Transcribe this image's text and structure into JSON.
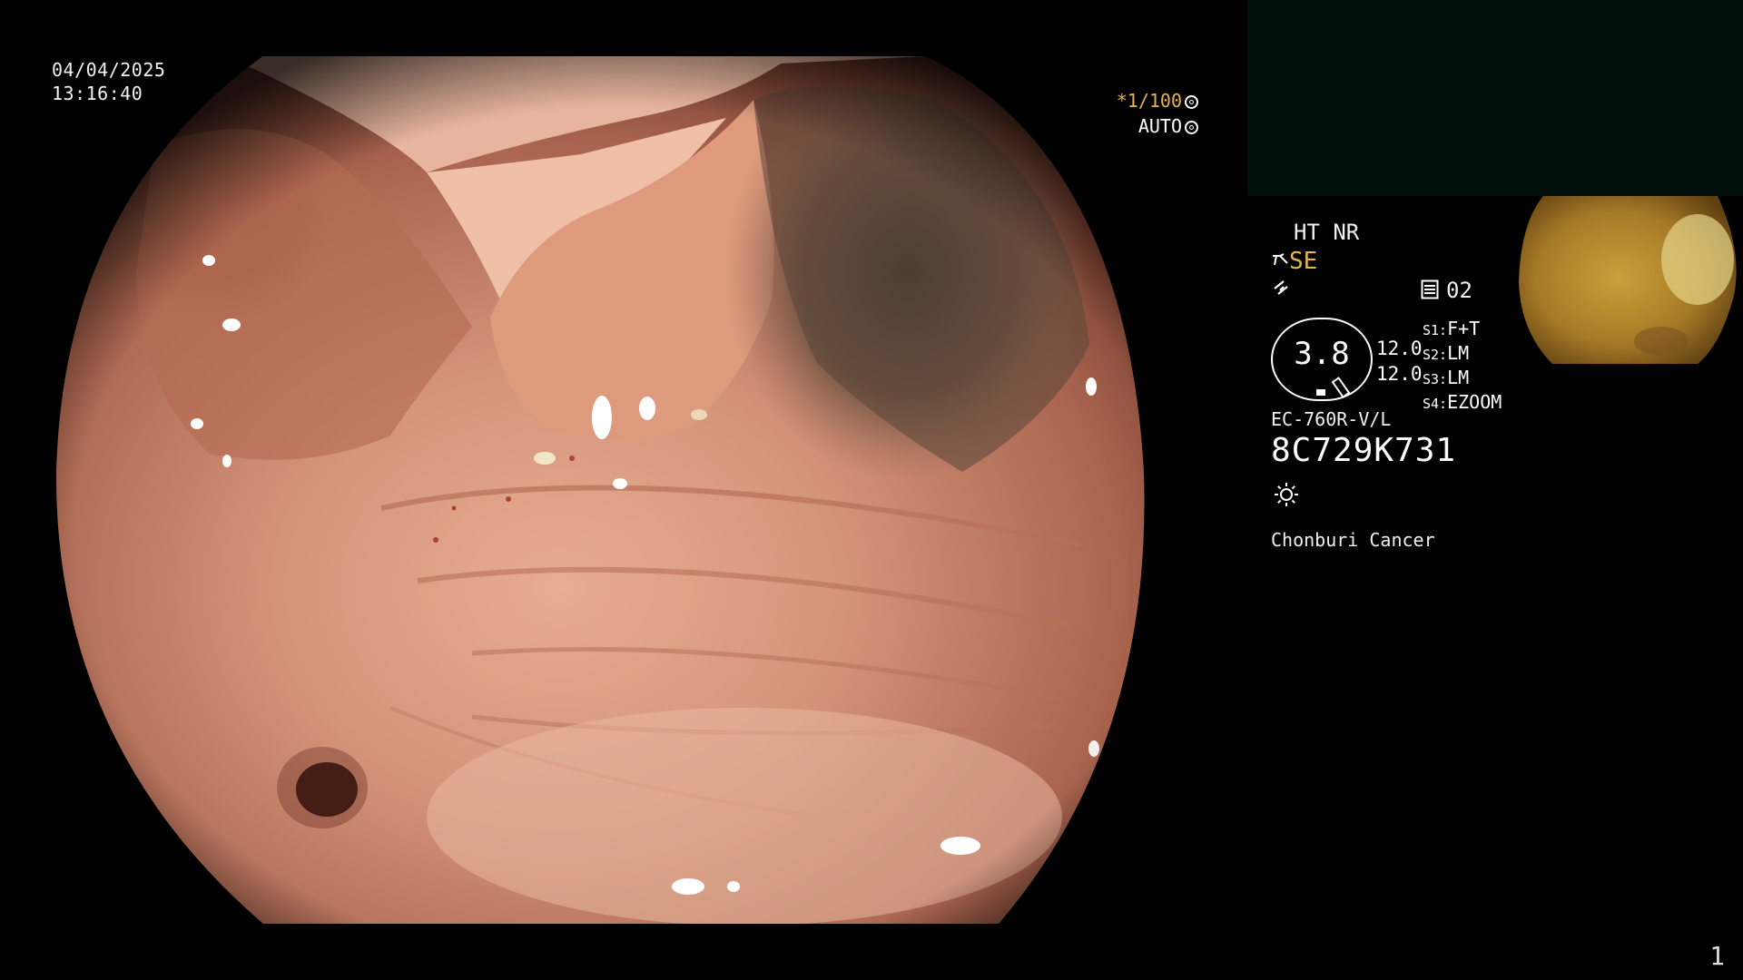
{
  "overlay": {
    "date": "04/04/2025",
    "time": "13:16:40",
    "shutter_value": "1/100",
    "shutter_prefix": "*",
    "exposure_mode": "AUTO"
  },
  "panel": {
    "mode_top": "HT NR",
    "enhancement": "SE",
    "memory_label": "02",
    "gauge_value": "3.8",
    "scale_values": [
      "12.0",
      "12.0"
    ],
    "switches": [
      {
        "key": "S1:",
        "value": "F+T"
      },
      {
        "key": "S2:",
        "value": "LM"
      },
      {
        "key": "S3:",
        "value": "LM"
      },
      {
        "key": "S4:",
        "value": "EZOOM"
      }
    ],
    "scope_model": "EC-760R-V/L",
    "serial_number": "8C729K731",
    "institution": "Chonburi Cancer"
  },
  "page_number": "1",
  "icons": [
    "scissor-icon",
    "lightning-icon",
    "memory-icon",
    "light-icon",
    "iris-icon",
    "aperture-icon"
  ],
  "colors": {
    "background": "#000000",
    "accent": "#e8b34a",
    "mucosa": "#c9826a",
    "sub_monitor": "#02100c"
  }
}
